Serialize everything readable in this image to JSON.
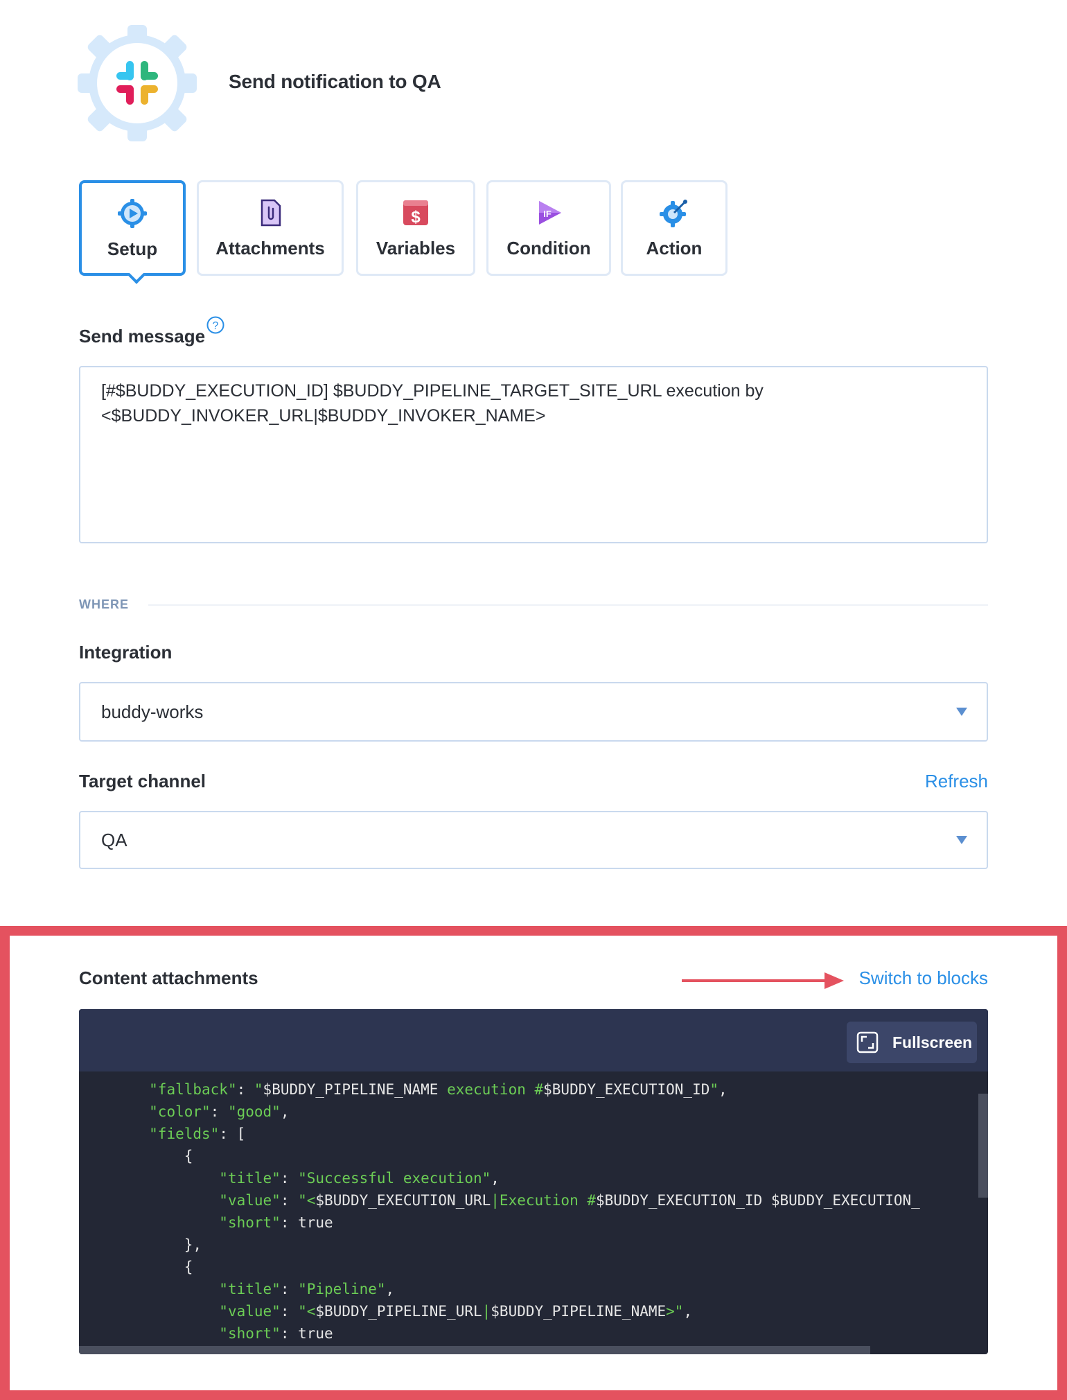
{
  "header": {
    "title": "Send notification to QA",
    "icon": "slack-logo-icon"
  },
  "tabs": [
    {
      "label": "Setup",
      "icon": "setup-play-gear-icon",
      "active": true
    },
    {
      "label": "Attachments",
      "icon": "attachment-file-icon",
      "active": false
    },
    {
      "label": "Variables",
      "icon": "dollar-variables-icon",
      "active": false
    },
    {
      "label": "Condition",
      "icon": "if-condition-icon",
      "active": false
    },
    {
      "label": "Action",
      "icon": "action-gear-icon",
      "active": false
    }
  ],
  "send_message": {
    "label": "Send message",
    "value": "[#$BUDDY_EXECUTION_ID] $BUDDY_PIPELINE_TARGET_SITE_URL execution by\n<$BUDDY_INVOKER_URL|$BUDDY_INVOKER_NAME>"
  },
  "where_section": {
    "label": "WHERE"
  },
  "integration": {
    "label": "Integration",
    "value": "buddy-works"
  },
  "target_channel": {
    "label": "Target channel",
    "refresh_label": "Refresh",
    "value": "QA"
  },
  "content_attachments": {
    "label": "Content attachments",
    "switch_label": "Switch to blocks",
    "fullscreen_label": "Fullscreen",
    "code_lines": [
      "        \"fallback\": \"$BUDDY_PIPELINE_NAME execution #$BUDDY_EXECUTION_ID\",",
      "        \"color\": \"good\",",
      "        \"fields\": [",
      "            {",
      "                \"title\": \"Successful execution\",",
      "                \"value\": \"<$BUDDY_EXECUTION_URL|Execution #$BUDDY_EXECUTION_ID $BUDDY_EXECUTION_",
      "                \"short\": true",
      "            },",
      "            {",
      "                \"title\": \"Pipeline\",",
      "                \"value\": \"<$BUDDY_PIPELINE_URL|$BUDDY_PIPELINE_NAME>\",",
      "                \"short\": true"
    ]
  },
  "colors": {
    "accent": "#2a8fe6",
    "highlight": "#e4525f",
    "code_bg": "#232735",
    "code_header": "#2d3551",
    "code_string": "#6ccd55"
  }
}
